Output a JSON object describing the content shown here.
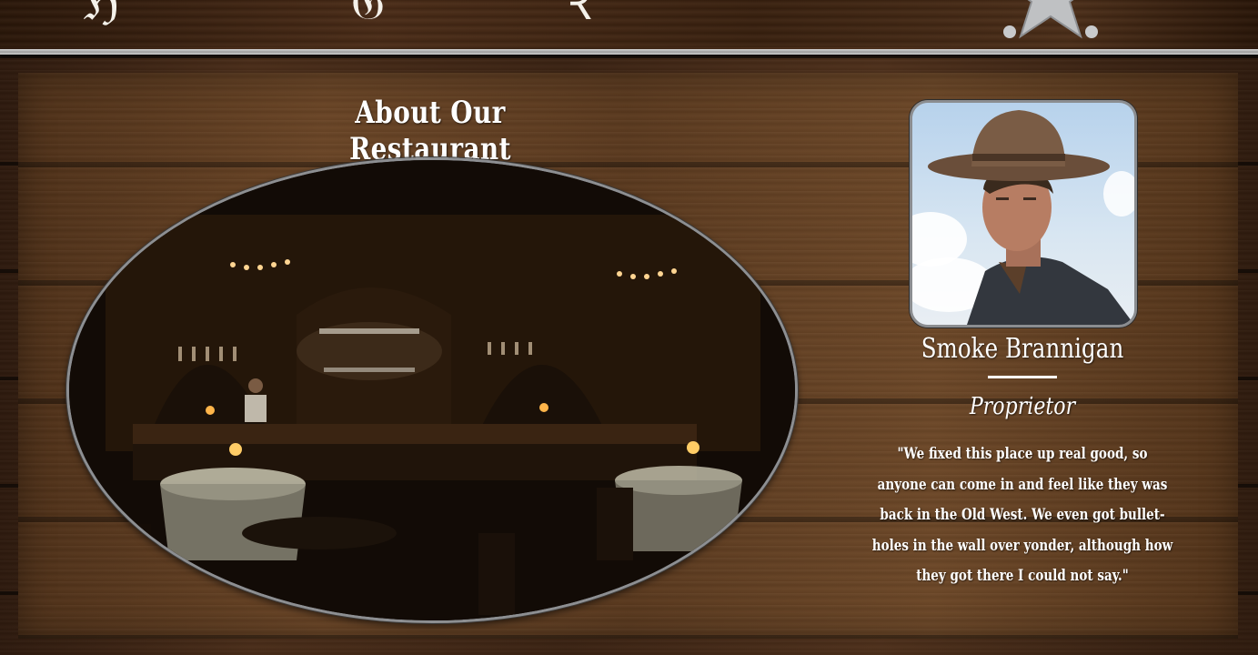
{
  "nav": {
    "items": [
      {
        "icon": "home-script-icon",
        "glyph": "ℌ"
      },
      {
        "icon": "menu-script-icon",
        "glyph": "𝔊"
      },
      {
        "icon": "revolver-icon",
        "glyph": "Ꝛ"
      },
      {
        "icon": "sheriff-star-icon"
      }
    ]
  },
  "about": {
    "title": "About Our Restaurant",
    "photo_icon": "saloon-interior-photo"
  },
  "owner": {
    "photo_icon": "cowboy-portrait-photo",
    "name": "Smoke Brannigan",
    "role": "Proprietor",
    "quote": "\"We fixed this place up real good, so anyone can come in and feel like they was back in the Old West. We even got bullet-holes in the wall over yonder, although how they got there I could not say.\""
  },
  "colors": {
    "wood_dark": "#3a2314",
    "wood_panel": "#5a3a20",
    "silver_rule": "#b5b5b5",
    "text": "#ffffff"
  }
}
